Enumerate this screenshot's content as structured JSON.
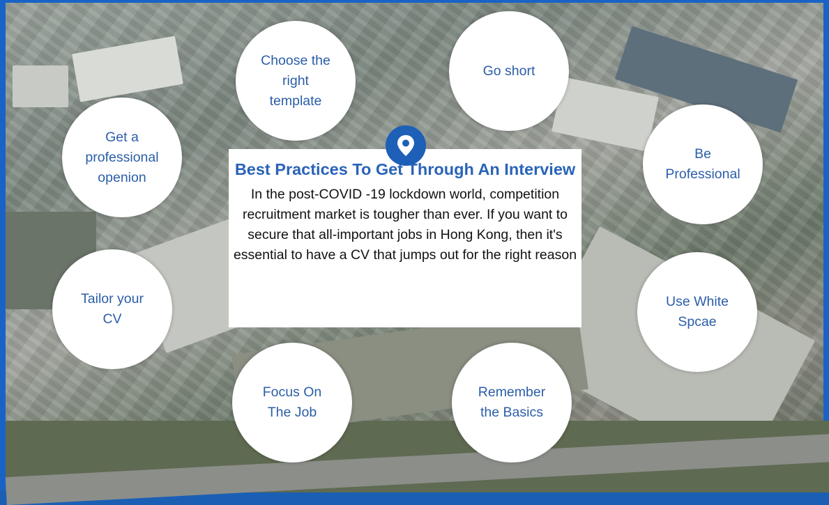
{
  "title": "Best Practices To Get Through An Interview",
  "description": "In  the post-COVID -19 lockdown world, competition recruitment market is tougher than ever. If you want to secure that all-important jobs in Hong Kong, then it's essential to have a CV that jumps out for the right reason",
  "tips": [
    {
      "label": "Choose the\nright\ntemplate"
    },
    {
      "label": "Go short"
    },
    {
      "label": "Get a\nprofessional\nopenion"
    },
    {
      "label": "Be\nProfessional"
    },
    {
      "label": "Tailor your\nCV"
    },
    {
      "label": "Use White\nSpcae"
    },
    {
      "label": "Focus On\nThe Job"
    },
    {
      "label": "Remember\nthe Basics"
    }
  ],
  "icons": {
    "center": "location-pin-icon"
  },
  "colors": {
    "accent": "#2a63b8",
    "border": "#1a63c6",
    "circle_text": "#2b5ea8"
  }
}
